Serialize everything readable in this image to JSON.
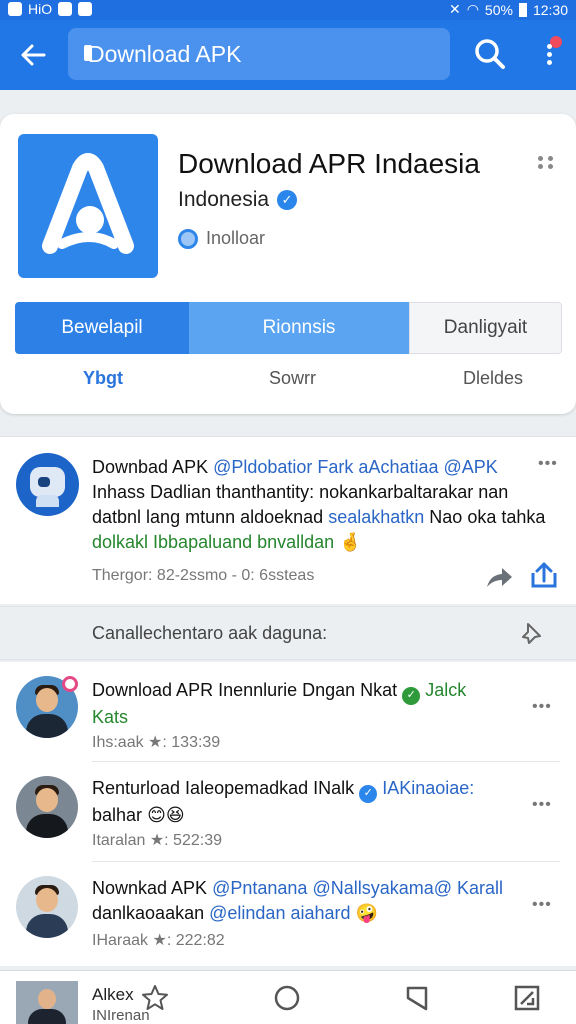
{
  "status_bar": {
    "left_label": "HiO",
    "battery": "50%",
    "time": "12:30"
  },
  "app_bar": {
    "search_text": "Download APK"
  },
  "hero": {
    "title": "Download APR Indaesia",
    "subtitle": "Indonesia",
    "meta": "Inolloar",
    "segments": [
      "Bewelapil",
      "Rionnsis",
      "Danligyait"
    ],
    "tabs": [
      "Ybgt",
      "Sowrr",
      "Dleldes"
    ]
  },
  "post": {
    "author": "Downbad APK",
    "line1_mention": "@Pldobatior Fark aAchatiaa @APK",
    "line2": "Inhass Dadlian thanthantity: nokankarbaltarakar nan",
    "line3_prefix": "datbnl lang mtunn aldoeknad",
    "line3_link": "sealakhatkn",
    "line3_suffix": "Nao oka tahka",
    "line4": "dolkakl Ibbapaluand bnvalldan",
    "line4_emoji": "🤞",
    "meta": "Thergor: 82-2ssmo - 0: 6ssteas",
    "more": "•••"
  },
  "section": {
    "title": "Canallechentaro aak daguna:"
  },
  "list": [
    {
      "text_main": "Download APR Inennlurie Dngan Nkat",
      "handle": "Jalck",
      "text_line2": "Kats",
      "emoji": "",
      "meta": "Ihs:aak ★: 133:39",
      "more": "•••"
    },
    {
      "text_main": "Renturload Ialeopemadkad INalk",
      "handle": "IAKinaoiae:",
      "text_line2": "balhar",
      "emoji": "😊😆",
      "meta": "Itaralan ★: 522:39",
      "more": "•••"
    },
    {
      "text_main": "Nownkad APK",
      "handle": "@Pntanana @Nallsyakama@ Karall",
      "text_line2_prefix": "danlkaoaakan",
      "text_line2_mention": "@elindan aiahard",
      "emoji": "🤪",
      "meta": "IHaraak ★: 222:82",
      "more": "•••"
    }
  ],
  "bottom_nav": {
    "name": "Alkex",
    "sub": "INIrenan"
  },
  "colors": {
    "primary": "#2177e6",
    "accent": "#2c80e6",
    "verified": "#2a86ea",
    "green_check": "#2e9a3a"
  }
}
